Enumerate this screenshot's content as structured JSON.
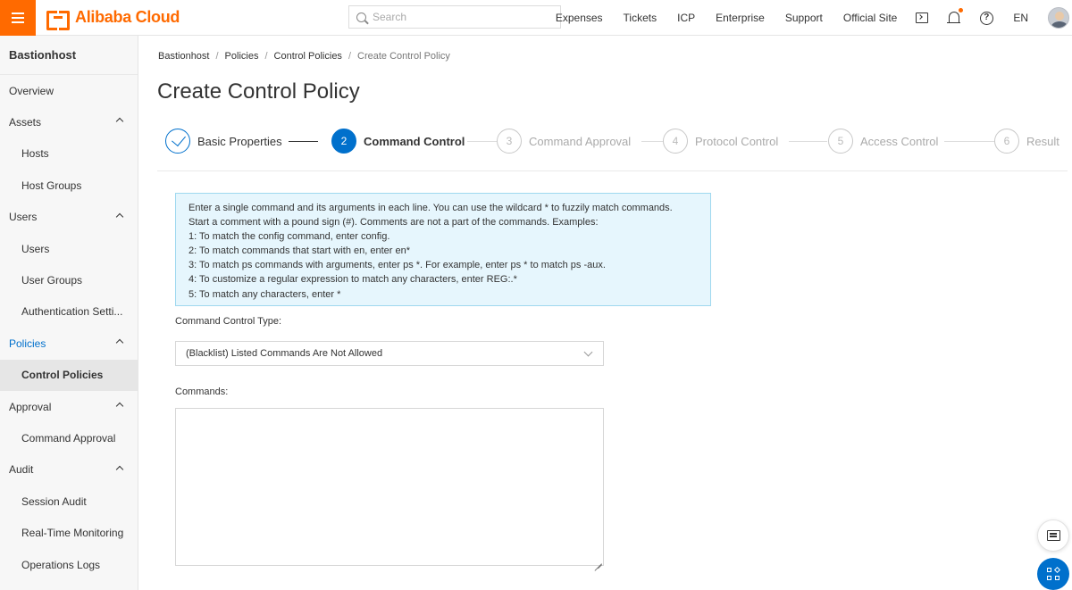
{
  "topbar": {
    "brand": "Alibaba Cloud",
    "search_placeholder": "Search",
    "nav_links": [
      "Expenses",
      "Tickets",
      "ICP",
      "Enterprise",
      "Support",
      "Official Site"
    ],
    "language": "EN",
    "icons": [
      "menu-icon",
      "terminal-icon",
      "bell-icon",
      "help-icon"
    ]
  },
  "sidebar": {
    "title": "Bastionhost",
    "items": [
      {
        "label": "Overview",
        "level": "top"
      },
      {
        "label": "Assets",
        "level": "top",
        "expanded": true
      },
      {
        "label": "Hosts",
        "level": "sub"
      },
      {
        "label": "Host Groups",
        "level": "sub"
      },
      {
        "label": "Users",
        "level": "top",
        "expanded": true
      },
      {
        "label": "Users",
        "level": "sub"
      },
      {
        "label": "User Groups",
        "level": "sub"
      },
      {
        "label": "Authentication Setti...",
        "level": "sub"
      },
      {
        "label": "Policies",
        "level": "top",
        "expanded": true,
        "active": true
      },
      {
        "label": "Control Policies",
        "level": "sub",
        "selected": true
      },
      {
        "label": "Approval",
        "level": "top",
        "expanded": true
      },
      {
        "label": "Command Approval",
        "level": "sub"
      },
      {
        "label": "Audit",
        "level": "top",
        "expanded": true
      },
      {
        "label": "Session Audit",
        "level": "sub"
      },
      {
        "label": "Real-Time Monitoring",
        "level": "sub"
      },
      {
        "label": "Operations Logs",
        "level": "sub"
      }
    ]
  },
  "breadcrumb": [
    "Bastionhost",
    "Policies",
    "Control Policies",
    "Create Control Policy"
  ],
  "page_title": "Create Control Policy",
  "steps": [
    {
      "number": "1",
      "label": "Basic Properties",
      "status": "done"
    },
    {
      "number": "2",
      "label": "Command Control",
      "status": "current"
    },
    {
      "number": "3",
      "label": "Command Approval",
      "status": "pending"
    },
    {
      "number": "4",
      "label": "Protocol Control",
      "status": "pending"
    },
    {
      "number": "5",
      "label": "Access Control",
      "status": "pending"
    },
    {
      "number": "6",
      "label": "Result",
      "status": "pending"
    }
  ],
  "notice_lines": [
    "Enter a single command and its arguments in each line. You can use the wildcard * to fuzzily match commands.",
    "Start a comment with a pound sign (#). Comments are not a part of the commands. Examples:",
    "1: To match the config command, enter config.",
    "2: To match commands that start with en, enter en*",
    "3: To match ps commands with arguments, enter ps *. For example, enter ps * to match ps -aux.",
    "4: To customize a regular expression to match any characters, enter REG:.*",
    "5: To match any characters, enter *"
  ],
  "form": {
    "type_label": "Command Control Type",
    "type_value": "(Blacklist) Listed Commands Are Not Allowed",
    "commands_label": "Commands",
    "commands_value": ""
  },
  "colors": {
    "brand": "#ff6a00",
    "primary": "#0070cc",
    "notice_bg": "#e6f6fd"
  }
}
